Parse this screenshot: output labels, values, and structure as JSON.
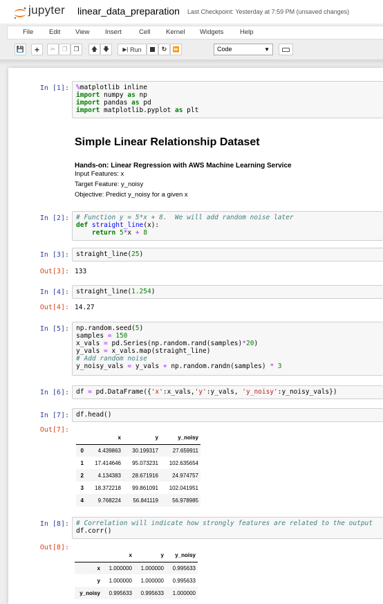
{
  "header": {
    "brand": "jupyter",
    "notebook_name": "linear_data_preparation",
    "checkpoint": "Last Checkpoint: Yesterday at 7:59 PM",
    "unsaved": "(unsaved changes)"
  },
  "menu": [
    "File",
    "Edit",
    "View",
    "Insert",
    "Cell",
    "Kernel",
    "Widgets",
    "Help"
  ],
  "toolbar": {
    "run_label": "Run",
    "cell_type": "Code"
  },
  "cells": {
    "c1": {
      "prompt": "In [1]:"
    },
    "md": {
      "title": "Simple Linear Relationship Dataset",
      "subtitle": "Hands-on: Linear Regression with AWS Machine Learning Service",
      "line1": "Input Features: x",
      "line2": "Target Feature: y_noisy",
      "line3": "Objective: Predict y_noisy for a given x"
    },
    "c2": {
      "prompt": "In [2]:"
    },
    "c3": {
      "prompt": "In [3]:",
      "out_prompt": "Out[3]:",
      "output": "133"
    },
    "c4": {
      "prompt": "In [4]:",
      "out_prompt": "Out[4]:",
      "output": "14.27"
    },
    "c5": {
      "prompt": "In [5]:"
    },
    "c6": {
      "prompt": "In [6]:"
    },
    "c7": {
      "prompt": "In [7]:",
      "out_prompt": "Out[7]:"
    },
    "c8": {
      "prompt": "In [8]:",
      "out_prompt": "Out[8]:"
    }
  },
  "head_table": {
    "columns": [
      "",
      "x",
      "y",
      "y_noisy"
    ],
    "rows": [
      [
        "0",
        "4.439863",
        "30.199317",
        "27.659911"
      ],
      [
        "1",
        "17.414646",
        "95.073231",
        "102.635654"
      ],
      [
        "2",
        "4.134383",
        "28.671916",
        "24.974757"
      ],
      [
        "3",
        "18.372218",
        "99.861091",
        "102.041951"
      ],
      [
        "4",
        "9.768224",
        "56.841119",
        "56.978985"
      ]
    ]
  },
  "corr_table": {
    "columns": [
      "",
      "x",
      "y",
      "y_noisy"
    ],
    "rows": [
      [
        "x",
        "1.000000",
        "1.000000",
        "0.995633"
      ],
      [
        "y",
        "1.000000",
        "1.000000",
        "0.995633"
      ],
      [
        "y_noisy",
        "0.995633",
        "0.995633",
        "1.000000"
      ]
    ]
  }
}
